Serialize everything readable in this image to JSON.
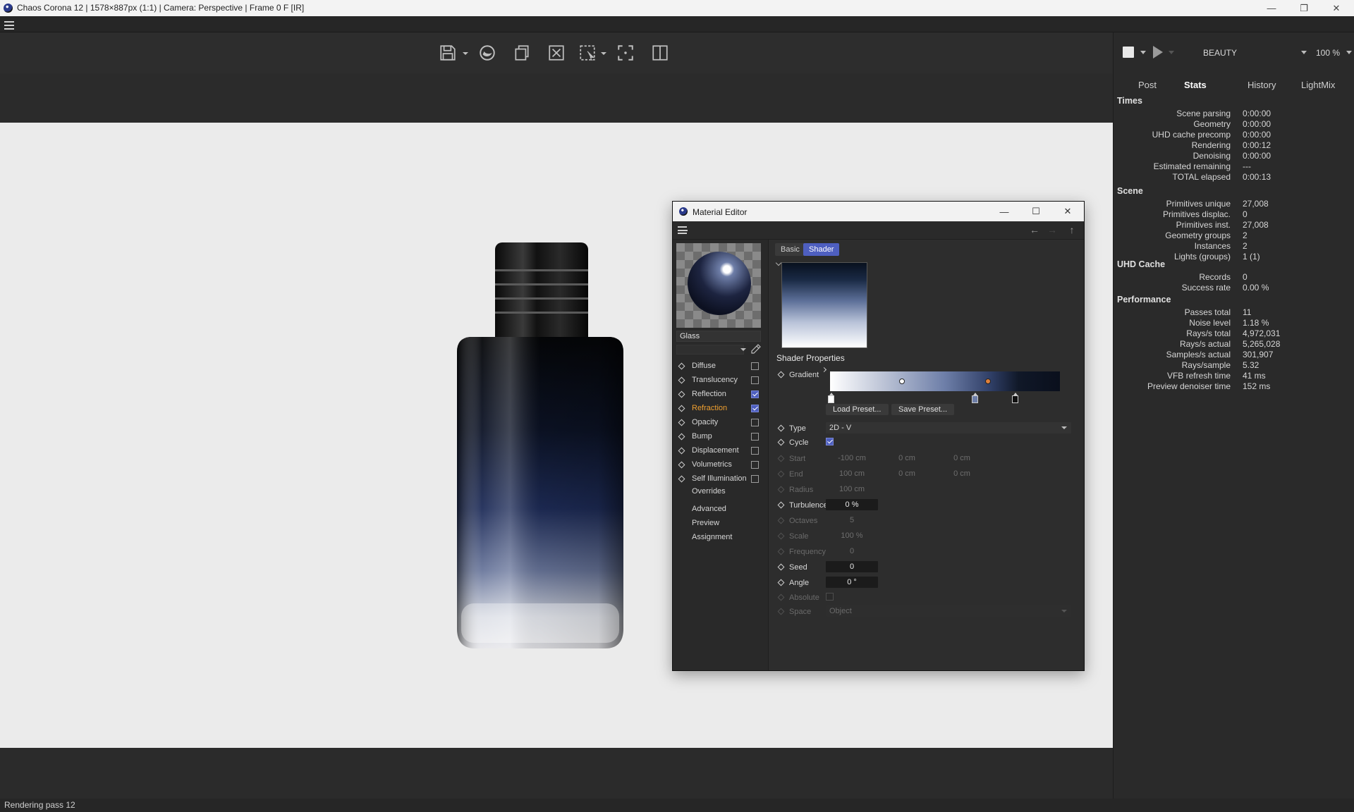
{
  "window": {
    "title": "Chaos Corona 12 | 1578×887px (1:1) | Camera: Perspective | Frame 0 F [IR]",
    "minimize": "—",
    "maximize": "❐",
    "close": "✕"
  },
  "status": "Rendering pass 12",
  "right_panel": {
    "channel": "BEAUTY",
    "zoom": "100 %",
    "tabs": [
      "Post",
      "Stats",
      "History",
      "LightMix"
    ],
    "active_tab": "Stats",
    "sections": [
      {
        "title": "Times",
        "rows": [
          {
            "key": "Scene parsing",
            "value": "0:00:00"
          },
          {
            "key": "Geometry",
            "value": "0:00:00"
          },
          {
            "key": "UHD cache precomp",
            "value": "0:00:00"
          },
          {
            "key": "Rendering",
            "value": "0:00:12"
          },
          {
            "key": "Denoising",
            "value": "0:00:00"
          },
          {
            "key": "Estimated remaining",
            "value": "---"
          },
          {
            "key": "TOTAL elapsed",
            "value": "0:00:13"
          }
        ]
      },
      {
        "title": "Scene",
        "rows": [
          {
            "key": "Primitives unique",
            "value": "27,008"
          },
          {
            "key": "Primitives displac.",
            "value": "0"
          },
          {
            "key": "Primitives inst.",
            "value": "27,008"
          },
          {
            "key": "Geometry groups",
            "value": "2"
          },
          {
            "key": "Instances",
            "value": "2"
          },
          {
            "key": "Lights (groups)",
            "value": "1 (1)"
          }
        ]
      },
      {
        "title": "UHD Cache",
        "rows": [
          {
            "key": "Records",
            "value": "0"
          },
          {
            "key": "Success rate",
            "value": "0.00 %"
          }
        ]
      },
      {
        "title": "Performance",
        "rows": [
          {
            "key": "Passes total",
            "value": "11"
          },
          {
            "key": "Noise level",
            "value": "1.18 %"
          },
          {
            "key": "Rays/s total",
            "value": "4,972,031"
          },
          {
            "key": "Rays/s actual",
            "value": "5,265,028"
          },
          {
            "key": "Samples/s actual",
            "value": "301,907"
          },
          {
            "key": "Rays/sample",
            "value": "5.32"
          },
          {
            "key": "VFB refresh time",
            "value": "41 ms"
          },
          {
            "key": "Preview denoiser time",
            "value": "152 ms"
          }
        ]
      }
    ]
  },
  "material_editor": {
    "title": "Material Editor",
    "material_name": "Glass",
    "channels": [
      {
        "label": "Diffuse",
        "checked": false,
        "active": false
      },
      {
        "label": "Translucency",
        "checked": false,
        "active": false
      },
      {
        "label": "Reflection",
        "checked": true,
        "active": false
      },
      {
        "label": "Refraction",
        "checked": true,
        "active": true
      },
      {
        "label": "Opacity",
        "checked": false,
        "active": false
      },
      {
        "label": "Bump",
        "checked": false,
        "active": false
      },
      {
        "label": "Displacement",
        "checked": false,
        "active": false
      },
      {
        "label": "Volumetrics",
        "checked": false,
        "active": false
      },
      {
        "label": "Self Illumination",
        "checked": false,
        "active": false
      }
    ],
    "links": [
      "Overrides",
      "Advanced",
      "Preview",
      "Assignment"
    ],
    "tabs": {
      "basic": "Basic",
      "shader": "Shader"
    },
    "section_title": "Shader Properties",
    "gradient_label": "Gradient",
    "load_preset": "Load Preset...",
    "save_preset": "Save Preset...",
    "props": {
      "type": {
        "label": "Type",
        "value": "2D - V"
      },
      "cycle": {
        "label": "Cycle",
        "checked": true
      },
      "start": {
        "label": "Start",
        "x": "-100 cm",
        "y": "0 cm",
        "z": "0 cm"
      },
      "end": {
        "label": "End",
        "x": "100 cm",
        "y": "0 cm",
        "z": "0 cm"
      },
      "radius": {
        "label": "Radius",
        "value": "100 cm"
      },
      "turbulence": {
        "label": "Turbulence",
        "value": "0 %"
      },
      "octaves": {
        "label": "Octaves",
        "value": "5"
      },
      "scale": {
        "label": "Scale",
        "value": "100 %"
      },
      "frequency": {
        "label": "Frequency",
        "value": "0"
      },
      "seed": {
        "label": "Seed",
        "value": "0"
      },
      "angle": {
        "label": "Angle",
        "value": "0 °"
      },
      "absolute": {
        "label": "Absolute",
        "checked": false
      },
      "space": {
        "label": "Space",
        "value": "Object"
      }
    }
  }
}
